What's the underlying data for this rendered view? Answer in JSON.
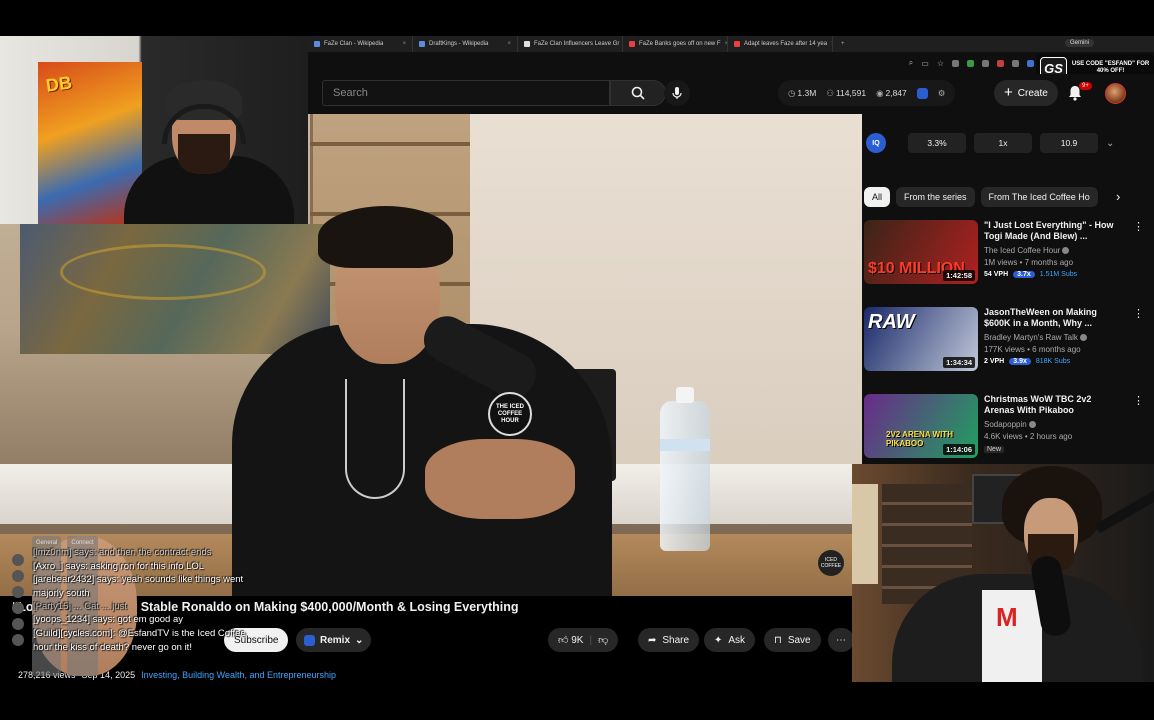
{
  "browser": {
    "tabs": [
      {
        "label": "FaZe Clan - Wikipedia",
        "color": "#5c8be0"
      },
      {
        "label": "DraftKings - Wikipedia",
        "color": "#5c8be0"
      },
      {
        "label": "FaZe Clan Influencers Leave Gr",
        "color": "#e0e0e0"
      },
      {
        "label": "FaZe Banks goes off on new F",
        "color": "#e84040"
      },
      {
        "label": "Adapt leaves Faze after 14 yea",
        "color": "#e84040"
      }
    ],
    "new_tab": "+",
    "gemini_label": "Gemini"
  },
  "promo": {
    "logo": "GS",
    "text": "USE CODE \"ESFAND\" FOR 40% OFF!"
  },
  "youtube": {
    "search_placeholder": "Search",
    "stats": {
      "subs": "1.3M",
      "views": "114,591",
      "watching": "2,847"
    },
    "create_label": "Create",
    "notif_count": "9+"
  },
  "player": {
    "mic_badge": "THE ICED COFFEE HOUR",
    "watermark": "ICED COFFEE"
  },
  "video": {
    "title": "“Lower Than A-Job!” Stable Ronaldo on Making $400,000/Month & Losing Everything",
    "subscribe_label": "Subscribe",
    "remix_label": "Remix",
    "likes": "9K",
    "share_label": "Share",
    "ask_label": "Ask",
    "save_label": "Save",
    "views": "278,216 views",
    "date": "Sep 14, 2025",
    "tags": "Investing, Building Wealth, and Entrepreneurship"
  },
  "sidebar": {
    "iq": {
      "logo": "IQ",
      "pct": "3.3%",
      "speed": "1x",
      "score": "10.9"
    },
    "chips": [
      "All",
      "From the series",
      "From The Iced Coffee Ho"
    ],
    "recommendations": [
      {
        "title": "\"I Just Lost Everything\" - How Togi Made (And Blew) ...",
        "channel": "The Iced Coffee Hour",
        "views": "1M views • 7 months ago",
        "duration": "1:42:58",
        "thumb_text": "$10 MILLION",
        "vph": "54 VPH",
        "mult": "3.7x",
        "subs": "1.51M Subs",
        "colors": [
          "#3a2418",
          "#b02020"
        ]
      },
      {
        "title": "JasonTheWeen on Making $600K in a Month, Why ...",
        "channel": "Bradley Martyn's Raw Talk",
        "views": "177K views • 6 months ago",
        "duration": "1:34:34",
        "thumb_text": "RAW",
        "vph": "2 VPH",
        "mult": "3.9x",
        "subs": "818K Subs",
        "colors": [
          "#1a2a6a",
          "#c0c8d8"
        ]
      },
      {
        "title": "Christmas WoW TBC 2v2 Arenas With Pikaboo",
        "channel": "Sodapoppin",
        "views": "4.6K views • 2 hours ago",
        "duration": "1:14:06",
        "thumb_text": "2V2 ARENA WITH PIKABOO",
        "new_label": "New",
        "colors": [
          "#6a2a8a",
          "#20a060"
        ]
      }
    ]
  },
  "chat": {
    "tabs": [
      "General",
      "Connect"
    ],
    "lines": [
      "[lmz0nm] says: and then the contract ends",
      "[Axro_] says: asking ron for this info LOL",
      "[jarebear2432] says: yeah sounds like things went majorly south",
      "[Party15] ... Cat ... just",
      "[yoops_1234] says: got em good ay",
      "[Guild][cycles.com]: @EsfandTV is the Iced Coffee hour the kiss of death? never go on it!"
    ]
  },
  "webcam2": {
    "shirt_letter": "M"
  }
}
